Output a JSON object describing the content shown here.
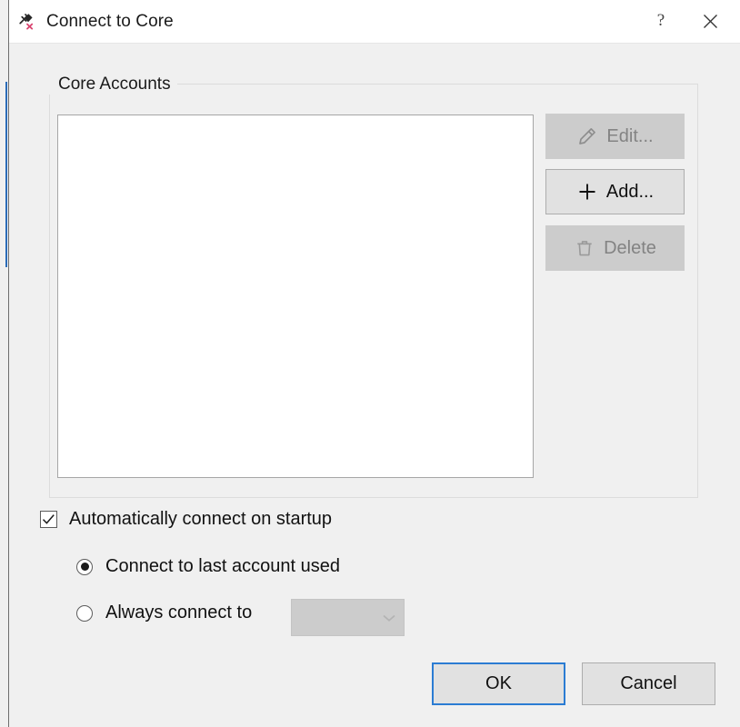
{
  "window": {
    "title": "Connect to Core",
    "icon": "plug-disconnected-icon",
    "help_label": "?",
    "close_label": "✕",
    "background_color": "#f0f0f0",
    "titlebar_color": "#ffffff",
    "accent_color": "#2b7cd3"
  },
  "group": {
    "legend": "Core Accounts",
    "listbox": {
      "items": [],
      "empty": true
    },
    "buttons": [
      {
        "label": "Edit...",
        "icon": "pencil-icon",
        "enabled": false
      },
      {
        "label": "Add...",
        "icon": "plus-icon",
        "enabled": true
      },
      {
        "label": "Delete",
        "icon": "trash-icon",
        "enabled": false
      }
    ]
  },
  "options": {
    "autoconnect": {
      "label": "Automatically connect on startup",
      "checked": true
    },
    "radios": [
      {
        "label": "Connect to last account used",
        "selected": true
      },
      {
        "label": "Always connect to",
        "selected": false
      }
    ],
    "combo": {
      "value": "",
      "placeholder": "",
      "enabled": false,
      "chevron": "chevron-down-icon"
    }
  },
  "footer": {
    "ok_label": "OK",
    "cancel_label": "Cancel"
  }
}
